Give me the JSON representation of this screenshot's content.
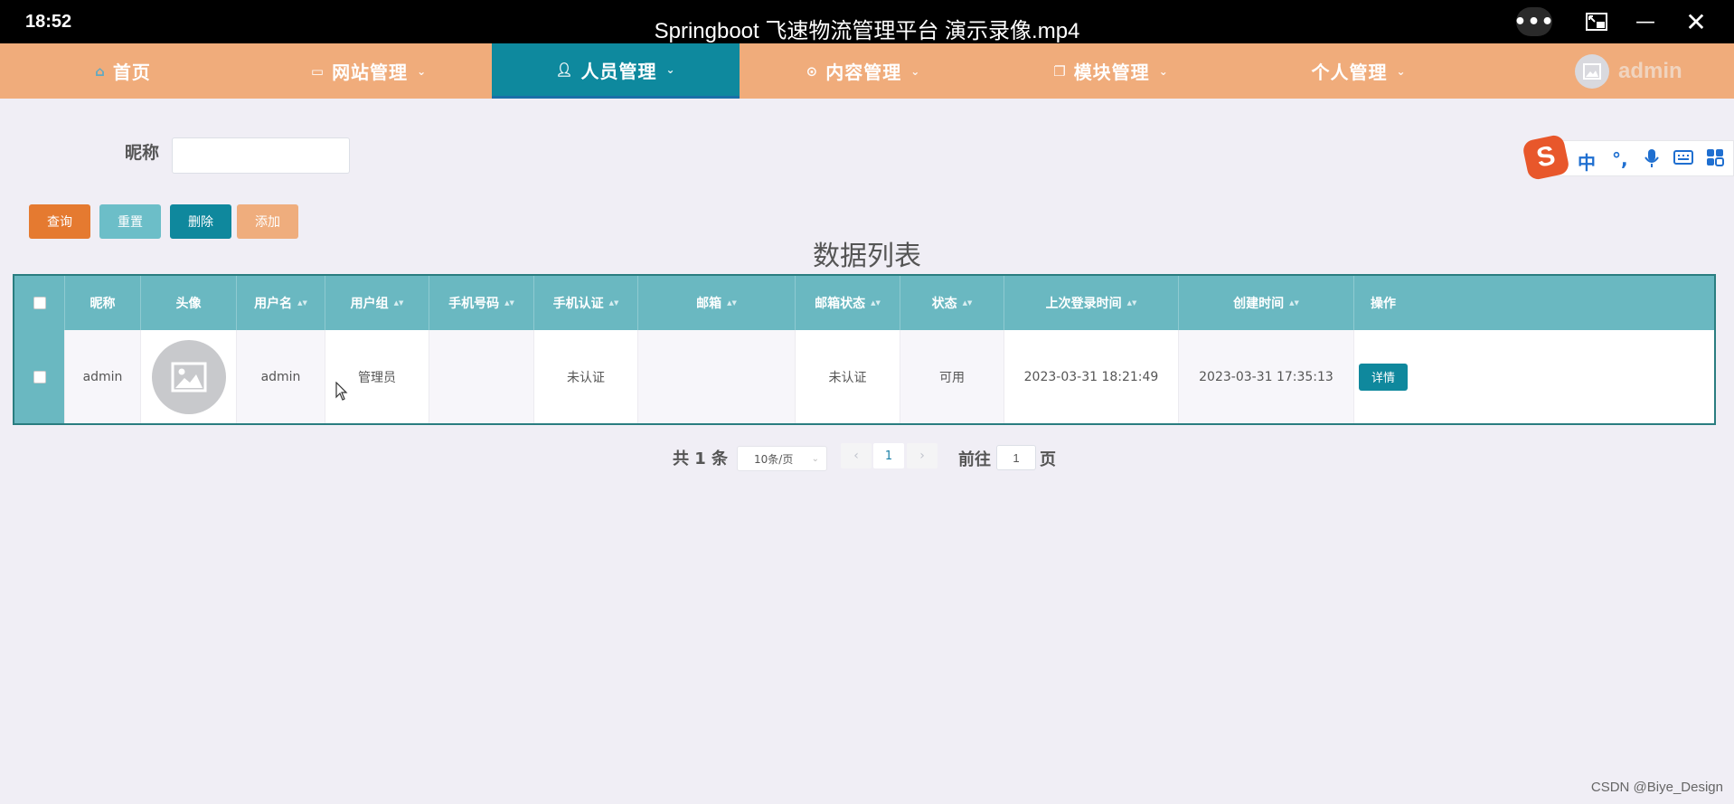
{
  "player": {
    "clock": "18:52",
    "title": "Springboot 飞速物流管理平台 演示录像.mp4",
    "more_icon": "more-icon",
    "pip_icon": "picture-in-picture-icon",
    "minimize_icon": "minimize-icon",
    "close_icon": "close-icon"
  },
  "nav": {
    "items": [
      {
        "label": "首页",
        "icon": "home-icon",
        "dropdown": false
      },
      {
        "label": "网站管理",
        "icon": "monitor-icon",
        "dropdown": true
      },
      {
        "label": "人员管理",
        "icon": "user-icon",
        "dropdown": true,
        "active": true
      },
      {
        "label": "内容管理",
        "icon": "content-icon",
        "dropdown": true
      },
      {
        "label": "模块管理",
        "icon": "module-icon",
        "dropdown": true
      },
      {
        "label": "个人管理",
        "icon": "",
        "dropdown": true
      }
    ],
    "username": "admin",
    "colors": {
      "bar": "#f0ac7b",
      "active": "#0e899e"
    }
  },
  "search": {
    "label": "昵称",
    "value": "",
    "placeholder": ""
  },
  "actions": {
    "query": "查询",
    "reset": "重置",
    "delete": "删除",
    "add": "添加"
  },
  "list_title": "数据列表",
  "table": {
    "columns": [
      "昵称",
      "头像",
      "用户名",
      "用户组",
      "手机号码",
      "手机认证",
      "邮箱",
      "邮箱状态",
      "状态",
      "上次登录时间",
      "创建时间",
      "操作"
    ],
    "rows": [
      {
        "nickname": "admin",
        "avatar_icon": "image-placeholder-icon",
        "username": "admin",
        "group": "管理员",
        "phone": "",
        "phone_verified": "未认证",
        "email": "",
        "email_status": "未认证",
        "status": "可用",
        "last_login": "2023-03-31 18:21:49",
        "created": "2023-03-31 17:35:13",
        "action": "详情"
      }
    ]
  },
  "pagination": {
    "total": "共 1 条",
    "page_size": "10条/页",
    "current": "1",
    "goto_prefix": "前往",
    "goto_value": "1",
    "goto_suffix": "页"
  },
  "ime": {
    "logo": "S",
    "lang": "中",
    "punct": "°,",
    "icons": [
      "microphone-icon",
      "keyboard-icon",
      "toolbox-icon"
    ]
  },
  "watermark": "CSDN @Biye_Design"
}
